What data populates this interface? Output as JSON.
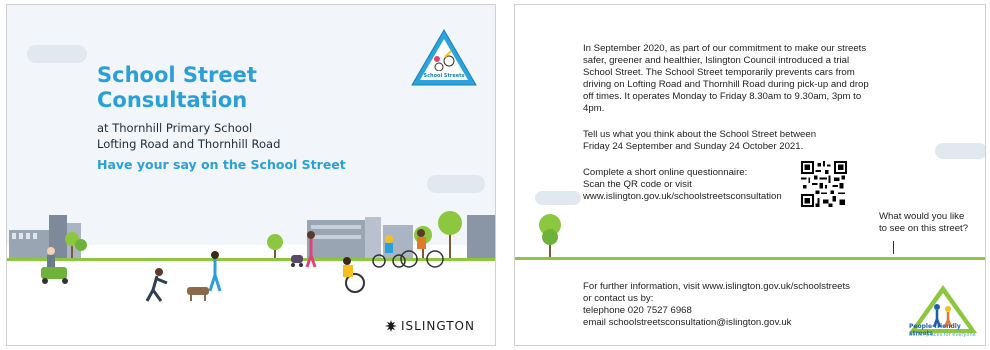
{
  "front": {
    "badge_text": "School Streets",
    "title_line1": "School Street",
    "title_line2": "Consultation",
    "line1": "at Thornhill Primary School",
    "line2": "Lofting Road and Thornhill Road",
    "subtitle": "Have your say on the School Street",
    "council_logo": "ISLINGTON"
  },
  "back": {
    "para1": [
      "In September 2020, as part of our commitment to make our streets",
      "safer, greener and healthier, Islington Council introduced a trial",
      "School Street. The School Street temporarily prevents cars from",
      "driving on Lofting Road and Thornhill Road during pick-up and drop",
      "off times. It operates Monday to Friday 8.30am to 9.30am, 3pm to",
      "4pm."
    ],
    "para2": [
      "Tell us what you think about the School Street between",
      "Friday 24 September and Sunday 24 October 2021."
    ],
    "para3": [
      "Complete a short online questionnaire:",
      "Scan the QR code or visit",
      "www.islington.gov.uk/schoolstreetsconsultation"
    ],
    "speech": [
      "What would you like",
      "to see on this street?"
    ],
    "para4": [
      "For further information, visit www.islington.gov.uk/schoolstreets",
      "or contact us by:",
      "telephone 020 7527 6968",
      "email schoolstreetsconsultation@islington.gov.uk"
    ],
    "pf_title": "People-friendly streets",
    "pf_tagline": "Better places for everyone"
  },
  "colors": {
    "accent_blue": "#2a9fd8",
    "green": "#8dc63f",
    "navy": "#1f5fa8"
  }
}
